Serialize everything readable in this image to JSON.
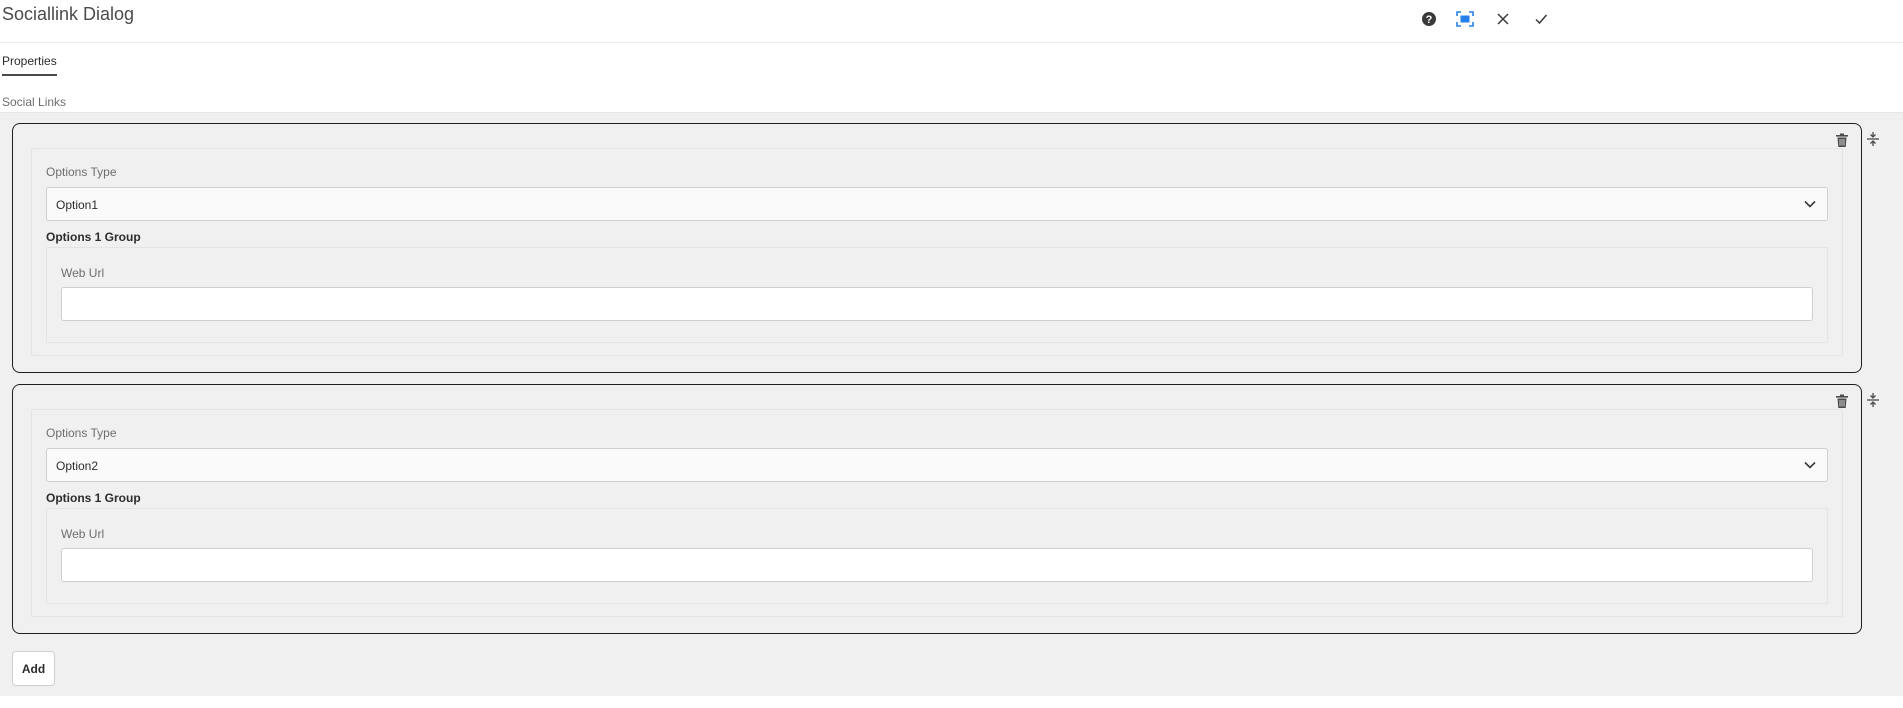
{
  "dialog": {
    "title": "Sociallink Dialog",
    "actions": {
      "help_icon": "help-icon",
      "fullscreen_icon": "fullscreen-icon",
      "cancel_icon": "close-icon",
      "done_icon": "checkmark-icon"
    }
  },
  "tabs": [
    {
      "label": "Properties",
      "selected": true
    }
  ],
  "social_links": {
    "label": "Social Links",
    "items": [
      {
        "options_type_label": "Options Type",
        "options_type_value": "Option1",
        "group_label": "Options 1 Group",
        "web_url_label": "Web Url",
        "web_url_value": ""
      },
      {
        "options_type_label": "Options Type",
        "options_type_value": "Option2",
        "group_label": "Options 1 Group",
        "web_url_label": "Web Url",
        "web_url_value": ""
      }
    ],
    "add_label": "Add"
  },
  "colors": {
    "panel_bg": "#f0f0f0",
    "item_border": "#1f1f1f",
    "text": "#2c2c2c",
    "muted_text": "#6e6e6e",
    "accent_blue": "#2680eb"
  }
}
